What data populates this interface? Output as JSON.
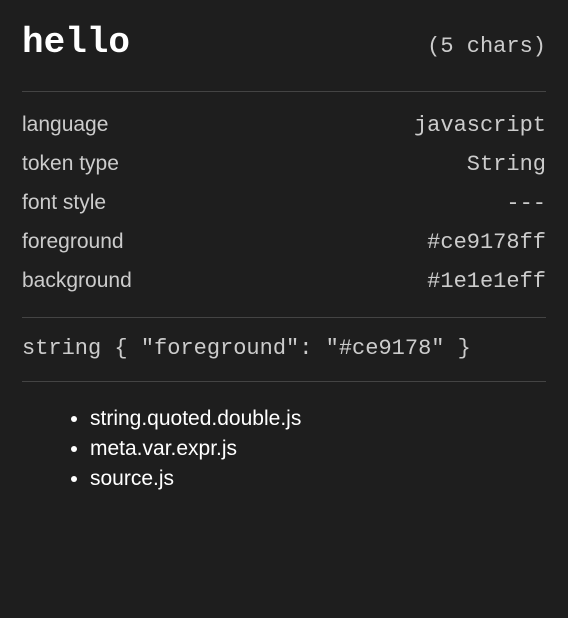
{
  "header": {
    "token": "hello",
    "charCount": "(5 chars)"
  },
  "props": {
    "language": {
      "key": "language",
      "value": "javascript"
    },
    "tokenType": {
      "key": "token type",
      "value": "String"
    },
    "fontStyle": {
      "key": "font style",
      "value": "---"
    },
    "foreground": {
      "key": "foreground",
      "value": "#ce9178ff"
    },
    "background": {
      "key": "background",
      "value": "#1e1e1eff"
    }
  },
  "rule": "string { \"foreground\": \"#ce9178\" }",
  "scopes": {
    "item0": "string.quoted.double.js",
    "item1": "meta.var.expr.js",
    "item2": "source.js"
  }
}
